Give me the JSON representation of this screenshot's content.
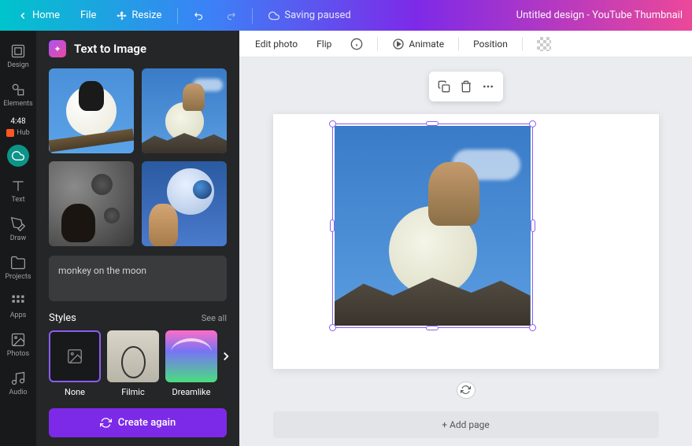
{
  "topbar": {
    "home": "Home",
    "file": "File",
    "resize": "Resize",
    "saving": "Saving paused",
    "doc_title": "Untitled design - YouTube Thumbnail"
  },
  "sidebar": {
    "items": [
      {
        "label": "Design"
      },
      {
        "label": "Elements"
      },
      {
        "label": "Text"
      },
      {
        "label": "Draw"
      },
      {
        "label": "Projects"
      },
      {
        "label": "Apps"
      },
      {
        "label": "Photos"
      },
      {
        "label": "Audio"
      }
    ],
    "time": "4:48",
    "hub": "Hub"
  },
  "panel": {
    "title": "Text to Image",
    "prompt": "monkey on the moon",
    "styles_label": "Styles",
    "see_all": "See all",
    "styles": [
      {
        "label": "None"
      },
      {
        "label": "Filmic"
      },
      {
        "label": "Dreamlike"
      }
    ],
    "create": "Create again"
  },
  "toolbar": {
    "edit_photo": "Edit photo",
    "flip": "Flip",
    "animate": "Animate",
    "position": "Position"
  },
  "canvas": {
    "add_page": "+ Add page"
  }
}
